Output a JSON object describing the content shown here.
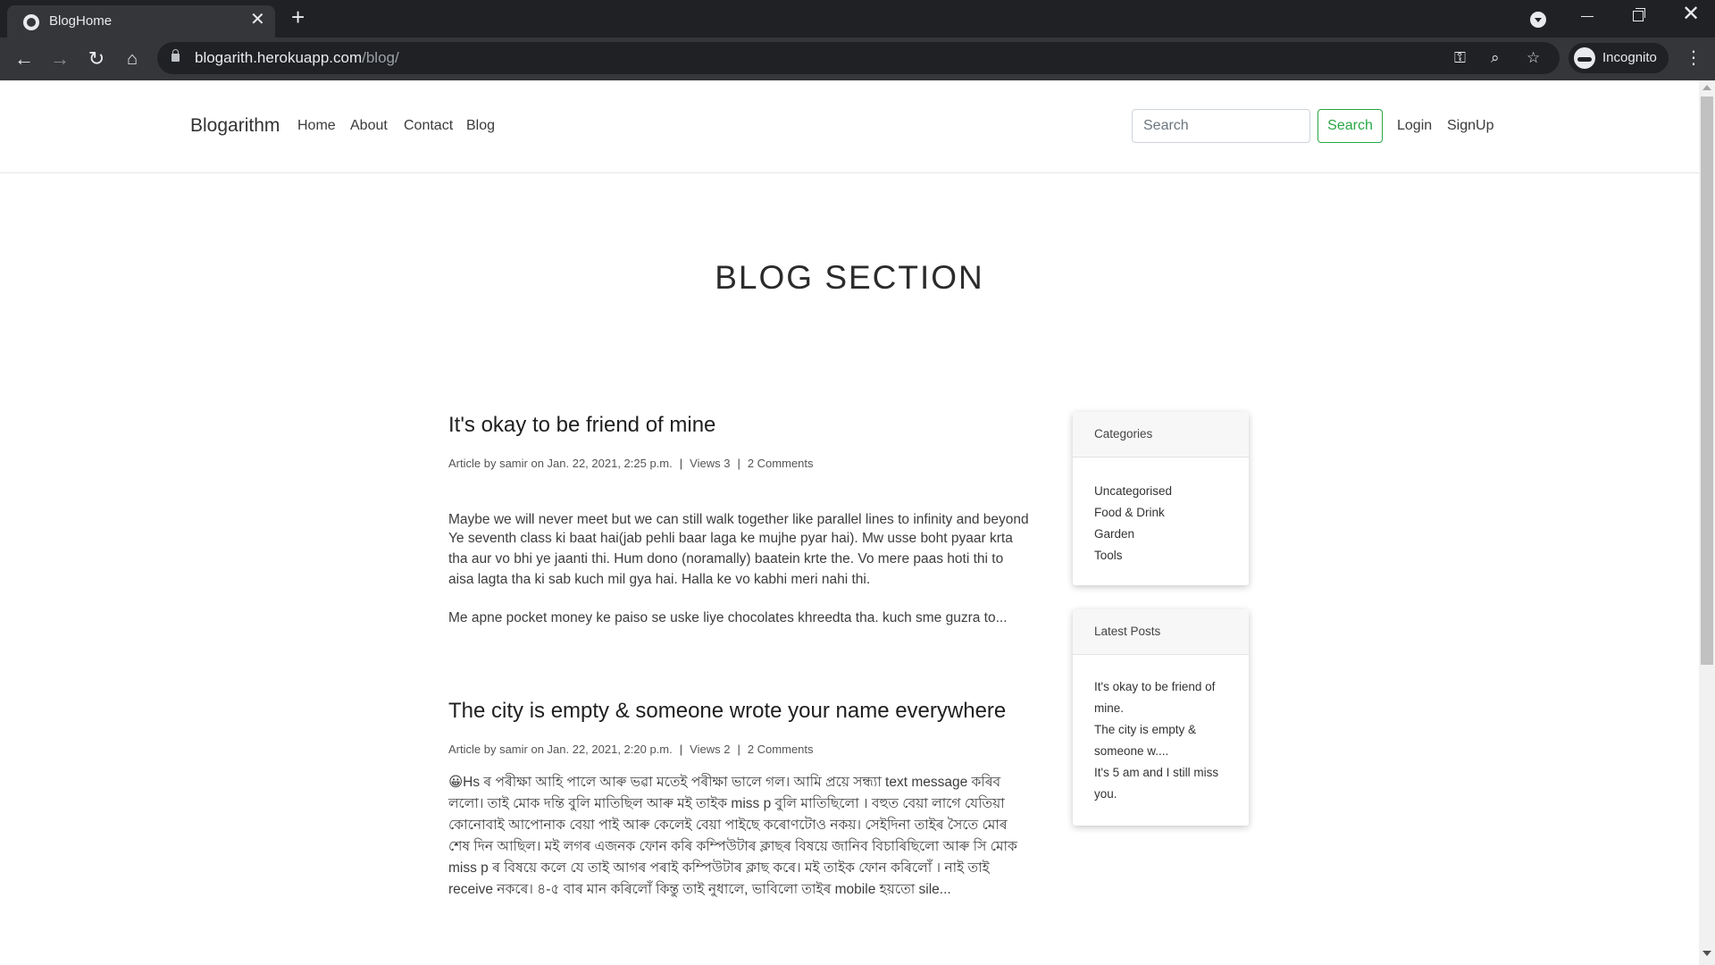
{
  "browser": {
    "tab_title": "BlogHome",
    "tab_close": "✕",
    "new_tab": "+",
    "url_host": "blogarith.herokuapp.com",
    "url_path": "/blog/",
    "profile_label": "Incognito"
  },
  "nav": {
    "brand": "Blogarithm",
    "links": [
      "Home",
      "About",
      "Contact",
      "Blog"
    ],
    "search_placeholder": "Search",
    "search_button": "Search",
    "login": "Login",
    "signup": "SignUp"
  },
  "page": {
    "title": "BLOG SECTION"
  },
  "posts": [
    {
      "title": "It's okay to be friend of mine",
      "meta_prefix": "Article by samir on Jan. 22, 2021, 2:25 p.m.",
      "views": "Views 3",
      "comments": "2 Comments",
      "paragraphs": [
        "Maybe we will never meet but we can still walk together like parallel lines to infinity and beyond",
        "Ye seventh class ki baat hai(jab pehli baar laga ke mujhe pyar hai). Mw usse boht pyaar krta tha aur vo bhi ye jaanti thi. Hum dono (noramally) baatein krte the. Vo mere paas hoti thi to aisa lagta tha ki sab kuch mil gya hai. Halla ke vo kabhi meri nahi thi.",
        "Me apne pocket money ke paiso se uske liye chocolates khreedta tha. kuch sme guzra to..."
      ]
    },
    {
      "title": "The city is empty & someone wrote your name everywhere",
      "meta_prefix": "Article by samir on Jan. 22, 2021, 2:20 p.m.",
      "views": "Views 2",
      "comments": "2 Comments",
      "paragraphs": [
        "😀Hs ৰ পৰীক্ষা আহি পালে আৰু ভৱা মতেই পৰীক্ষা ভালে গল। আমি প্ৰয়ে সন্ধ্যা text message কৰিব ললো। তাই মোক দন্তি বুলি মাতিছিল আৰু মই তাইক miss p বুলি মাতিছিলো । বহুত বেয়া লাগে যেতিয়া কোনোবাই আপোনাক বেয়া পাই আৰু কেলেই বেয়া পাইছে কৰোণটোও নকয়। সেইদিনা তাইৰ সৈতে মোৰ শেষ দিন আছিল। মই লগৰ এজনক ফোন কৰি কম্পিউটাৰ ক্লাছৰ বিষয়ে জানিব বিচাৰিছিলো আৰু সি মোক miss p ৰ বিষয়ে কলে যে তাই আগৰ পৰাই কম্পিউটাৰ ক্লাছ কৰে। মই তাইক ফোন কৰিলোঁ । নাই তাই receive নকৰে। ৪-৫ বাৰ মান কৰিলোঁ কিন্তু তাই নুধালে, ভাবিলো তাইৰ mobile হয়তো sile..."
      ]
    }
  ],
  "sidebar": {
    "categories_title": "Categories",
    "categories": [
      "Uncategorised",
      "Food & Drink",
      "Garden",
      "Tools"
    ],
    "latest_title": "Latest Posts",
    "latest": [
      "It's okay to be friend of mine.",
      "The city is empty & someone w....",
      "It's 5 am and I still miss you."
    ]
  }
}
